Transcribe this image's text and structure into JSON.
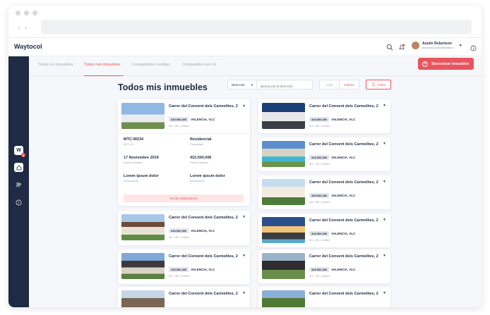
{
  "app": {
    "name": "Waytocol"
  },
  "user": {
    "name": "Austin Robertson",
    "role": "Marketing Administration"
  },
  "sidebar": {
    "logo_letter": "W",
    "badge": "3"
  },
  "tabs": [
    {
      "label": "Todos los inmuebles"
    },
    {
      "label": "Todos mis inmuebles"
    },
    {
      "label": "Compartidos conmigo"
    },
    {
      "label": "Compartidos por mí"
    }
  ],
  "sync_button": {
    "label": "Sincronizar inmuebles"
  },
  "page_title": "Todos mis inmuebles",
  "filters": {
    "address_select": "Dirección",
    "search_placeholder": "Buscar por la dirección",
    "view_list": "Lista",
    "view_gallery": "Galería",
    "filter_label": "Filtrar"
  },
  "card_text": {
    "title": "Carrer del Convent dels Carmelites, 2",
    "price": "345.500,00€",
    "city": "VALENCIA, VLC",
    "meta": "3H  •  2B  •  105m2"
  },
  "expanded": {
    "ref_value": "MTC-W234",
    "ref_label": "MTC ID",
    "type_value": "Residencial",
    "type_label": "Propiedad",
    "date_value": "17 Noviembre 2019",
    "date_label": "Fecha añadida",
    "prev_value": "415.500,00€",
    "prev_label": "Precio anterior",
    "info1_value": "Lorem ipsum dolor",
    "info1_label": "Información",
    "info2_value": "Lorem ipsum dolor",
    "info2_label": "Información",
    "collab_label": "Iniciar colaboración"
  },
  "colors": {
    "navy": "#1f2a44",
    "accent": "#e8555e"
  }
}
